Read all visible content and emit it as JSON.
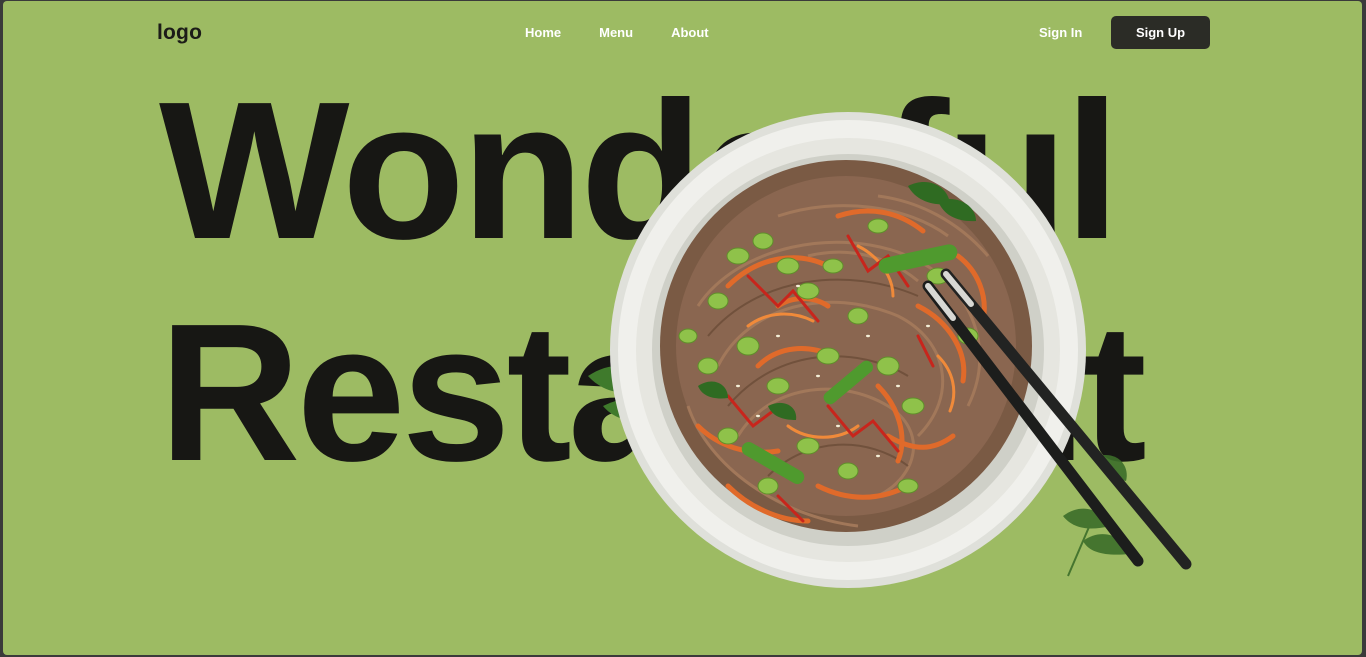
{
  "header": {
    "logo": "logo",
    "nav": [
      "Home",
      "Menu",
      "About"
    ],
    "sign_in": "Sign In",
    "sign_up": "Sign Up"
  },
  "hero": {
    "line1": "Wonderful",
    "line2": "Restaurant"
  },
  "colors": {
    "background": "#9dbb63",
    "text_dark": "#171714",
    "button_dark": "#2b2c26",
    "nav_text": "#ffffff"
  },
  "image": {
    "subject": "bowl of soba noodles with edamame, carrots and chopsticks"
  }
}
